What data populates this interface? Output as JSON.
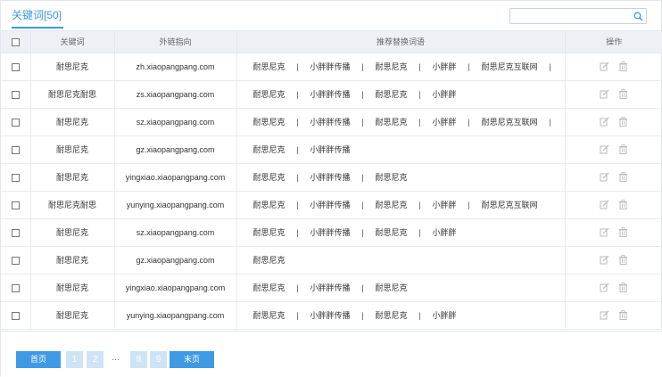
{
  "header": {
    "title": "关键词[50]",
    "search_placeholder": ""
  },
  "columns": {
    "checkbox": "",
    "keyword": "关键词",
    "link": "外链指向",
    "recs": "推荐替换词语",
    "ops": "操作"
  },
  "rows": [
    {
      "keyword": "耐思尼克",
      "link": "zh.xiaopangpang.com",
      "recs": [
        "耐思尼克",
        "小胖胖传播",
        "耐思尼克",
        "小胖胖",
        "耐思尼克互联网"
      ],
      "more": "······"
    },
    {
      "keyword": "耐思尼克耐思",
      "link": "zs.xiaopangpang.com",
      "recs": [
        "耐思尼克",
        "小胖胖传播",
        "耐思尼克",
        "小胖胖"
      ],
      "more": ""
    },
    {
      "keyword": "耐思尼克",
      "link": "sz.xiaopangpang.com",
      "recs": [
        "耐思尼克",
        "小胖胖传播",
        "耐思尼克",
        "小胖胖",
        "耐思尼克互联网"
      ],
      "more": "······"
    },
    {
      "keyword": "耐思尼克",
      "link": "gz.xiaopangpang.com",
      "recs": [
        "耐思尼克",
        "小胖胖传播"
      ],
      "more": ""
    },
    {
      "keyword": "耐思尼克",
      "link": "yingxiao.xiaopangpang.com",
      "recs": [
        "耐思尼克",
        "小胖胖传播",
        "耐思尼克"
      ],
      "more": ""
    },
    {
      "keyword": "耐思尼克耐思",
      "link": "yunying.xiaopangpang.com",
      "recs": [
        "耐思尼克",
        "小胖胖传播",
        "耐思尼克",
        "小胖胖",
        "耐思尼克互联网"
      ],
      "more": ""
    },
    {
      "keyword": "耐思尼克",
      "link": "sz.xiaopangpang.com",
      "recs": [
        "耐思尼克",
        "小胖胖传播",
        "耐思尼克",
        "小胖胖"
      ],
      "more": ""
    },
    {
      "keyword": "耐思尼克",
      "link": "gz.xiaopangpang.com",
      "recs": [
        "耐思尼克"
      ],
      "more": ""
    },
    {
      "keyword": "耐思尼克",
      "link": "yingxiao.xiaopangpang.com",
      "recs": [
        "耐思尼克",
        "小胖胖传播",
        "耐思尼克"
      ],
      "more": ""
    },
    {
      "keyword": "耐思尼克",
      "link": "yunying.xiaopangpang.com",
      "recs": [
        "耐思尼克",
        "小胖胖传播",
        "耐思尼克",
        "小胖胖"
      ],
      "more": ""
    }
  ],
  "separator": "|",
  "icons": {
    "edit": "edit-icon",
    "delete": "trash-icon",
    "search": "search-icon"
  },
  "pagination": {
    "first": "首页",
    "pages": [
      "1",
      "2",
      "8",
      "9"
    ],
    "ellipsis": "···",
    "last": "末页",
    "current": "1"
  },
  "colors": {
    "accent": "#3a9be6",
    "header_bg": "#edf1f6",
    "page_num_bg": "#cfe3f6"
  }
}
